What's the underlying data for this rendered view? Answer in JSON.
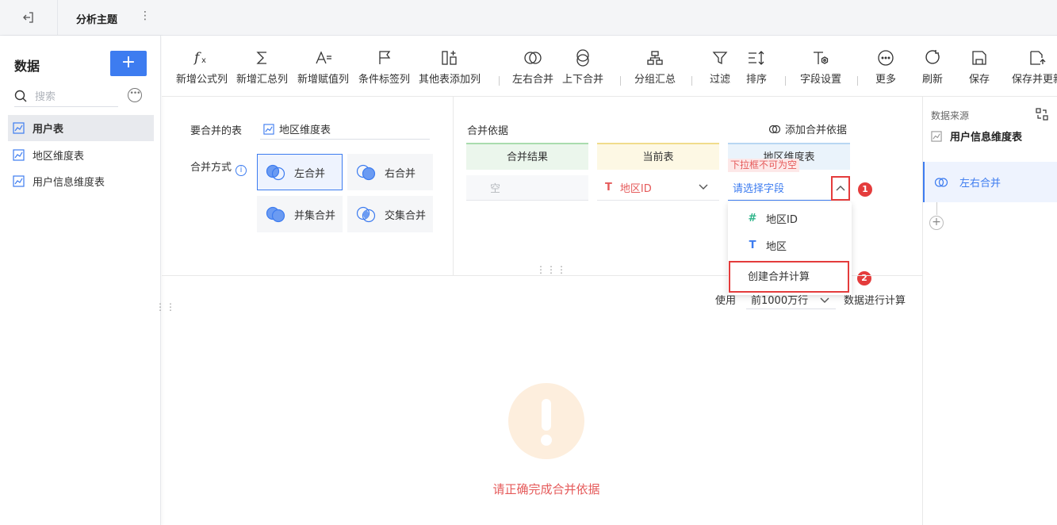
{
  "topbar": {
    "title": "分析主题"
  },
  "sidebar": {
    "heading": "数据",
    "add_label": "+",
    "search_placeholder": "搜索",
    "items": [
      {
        "label": "用户表",
        "active": true
      },
      {
        "label": "地区维度表",
        "active": false
      },
      {
        "label": "用户信息维度表",
        "active": false
      }
    ]
  },
  "toolbar": {
    "buttons": [
      {
        "label": "新增公式列",
        "icon": "fx-icon"
      },
      {
        "label": "新增汇总列",
        "icon": "sigma-icon"
      },
      {
        "label": "新增赋值列",
        "icon": "assign-icon"
      },
      {
        "label": "条件标签列",
        "icon": "flag-icon"
      },
      {
        "label": "其他表添加列",
        "icon": "add-column-icon"
      },
      {
        "label": "左右合并",
        "icon": "merge-lr-icon"
      },
      {
        "label": "上下合并",
        "icon": "merge-ud-icon"
      },
      {
        "label": "分组汇总",
        "icon": "group-icon"
      },
      {
        "label": "过滤",
        "icon": "filter-icon"
      },
      {
        "label": "排序",
        "icon": "sort-icon"
      },
      {
        "label": "字段设置",
        "icon": "field-settings-icon"
      },
      {
        "label": "更多",
        "icon": "more-icon"
      },
      {
        "label": "刷新",
        "icon": "refresh-icon"
      },
      {
        "label": "保存",
        "icon": "save-icon"
      },
      {
        "label": "保存并更新",
        "icon": "save-update-icon"
      }
    ]
  },
  "config": {
    "table_label": "要合并的表",
    "table_value": "地区维度表",
    "method_label": "合并方式",
    "info_glyph": "i",
    "methods": [
      {
        "label": "左合并",
        "active": true
      },
      {
        "label": "右合并",
        "active": false
      },
      {
        "label": "并集合并",
        "active": false
      },
      {
        "label": "交集合并",
        "active": false
      }
    ],
    "basis_label": "合并依据",
    "add_basis_label": "添加合并依据",
    "columns": {
      "result": "合并结果",
      "current": "当前表",
      "region": "地区维度表"
    },
    "result_value": "空",
    "current_value": "地区ID",
    "region_placeholder": "请选择字段",
    "error_tag": "下拉框不可为空",
    "dropdown": [
      {
        "label": "地区ID",
        "type": "#",
        "type_color": "#2fb58a"
      },
      {
        "label": "地区",
        "type": "T",
        "type_color": "#3d7cf0"
      },
      {
        "label": "创建合并计算",
        "type": "",
        "type_color": ""
      }
    ],
    "badges": [
      "1",
      "2"
    ]
  },
  "preview": {
    "use_label": "使用",
    "limit_value": "前1000万行",
    "calc_label": "数据进行计算",
    "message": "请正确完成合并依据"
  },
  "right_panel": {
    "source_label": "数据来源",
    "source_table": "用户信息维度表",
    "step_label": "左右合并"
  },
  "colors": {
    "accent": "#3d7cf0",
    "error": "#e43c3c"
  }
}
